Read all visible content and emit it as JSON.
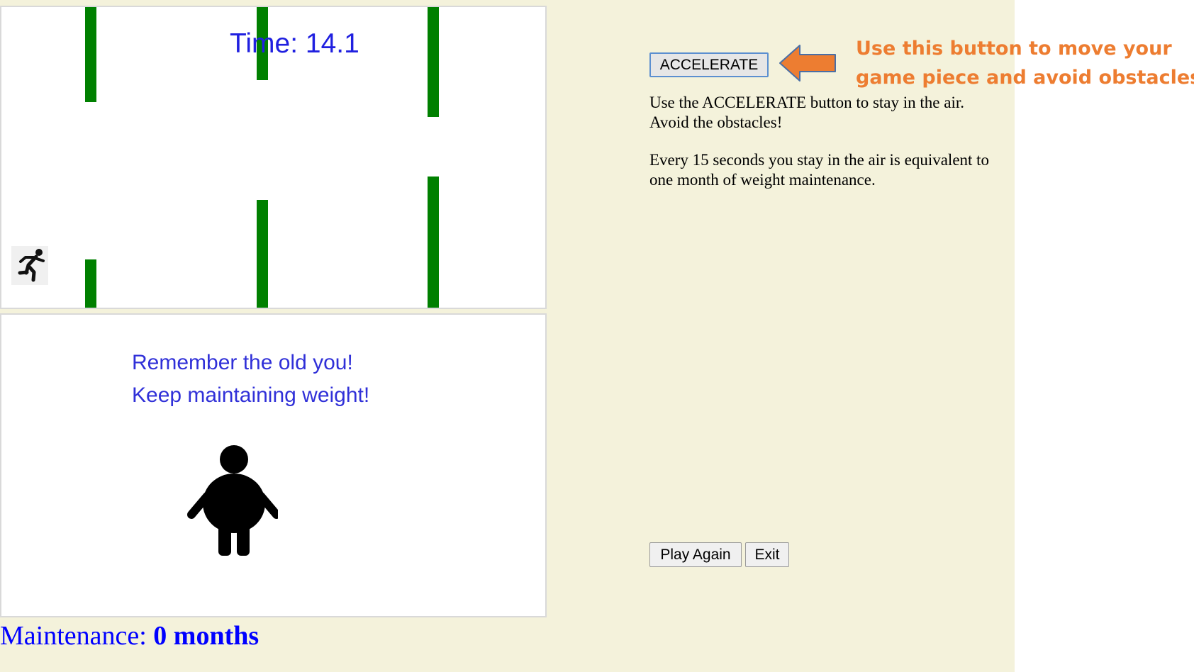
{
  "game": {
    "timer_label": "Time: 14.1",
    "runner_icon": "running-person-icon",
    "obstacle_color": "#008000"
  },
  "message": {
    "line1": "Remember the old you!",
    "line2": "Keep maintaining weight!",
    "figure_icon": "person-silhouette-icon"
  },
  "maintenance": {
    "label": "Maintenance:",
    "value": "0 months"
  },
  "controls": {
    "accelerate_label": "ACCELERATE",
    "play_again_label": "Play Again",
    "exit_label": "Exit"
  },
  "instructions": {
    "p1": "Use the ACCELERATE button to stay in the air. Avoid the obstacles!",
    "p2": "Every 15 seconds you stay in the air is equivalent to one month of weight maintenance."
  },
  "annotation": {
    "line1": "Use this button to move your",
    "line2": "game piece and avoid obstacles !",
    "color": "#ed7d31",
    "arrow_icon": "left-arrow-icon"
  },
  "colors": {
    "page_background": "#f4f2db",
    "text_blue": "#0000ff"
  }
}
